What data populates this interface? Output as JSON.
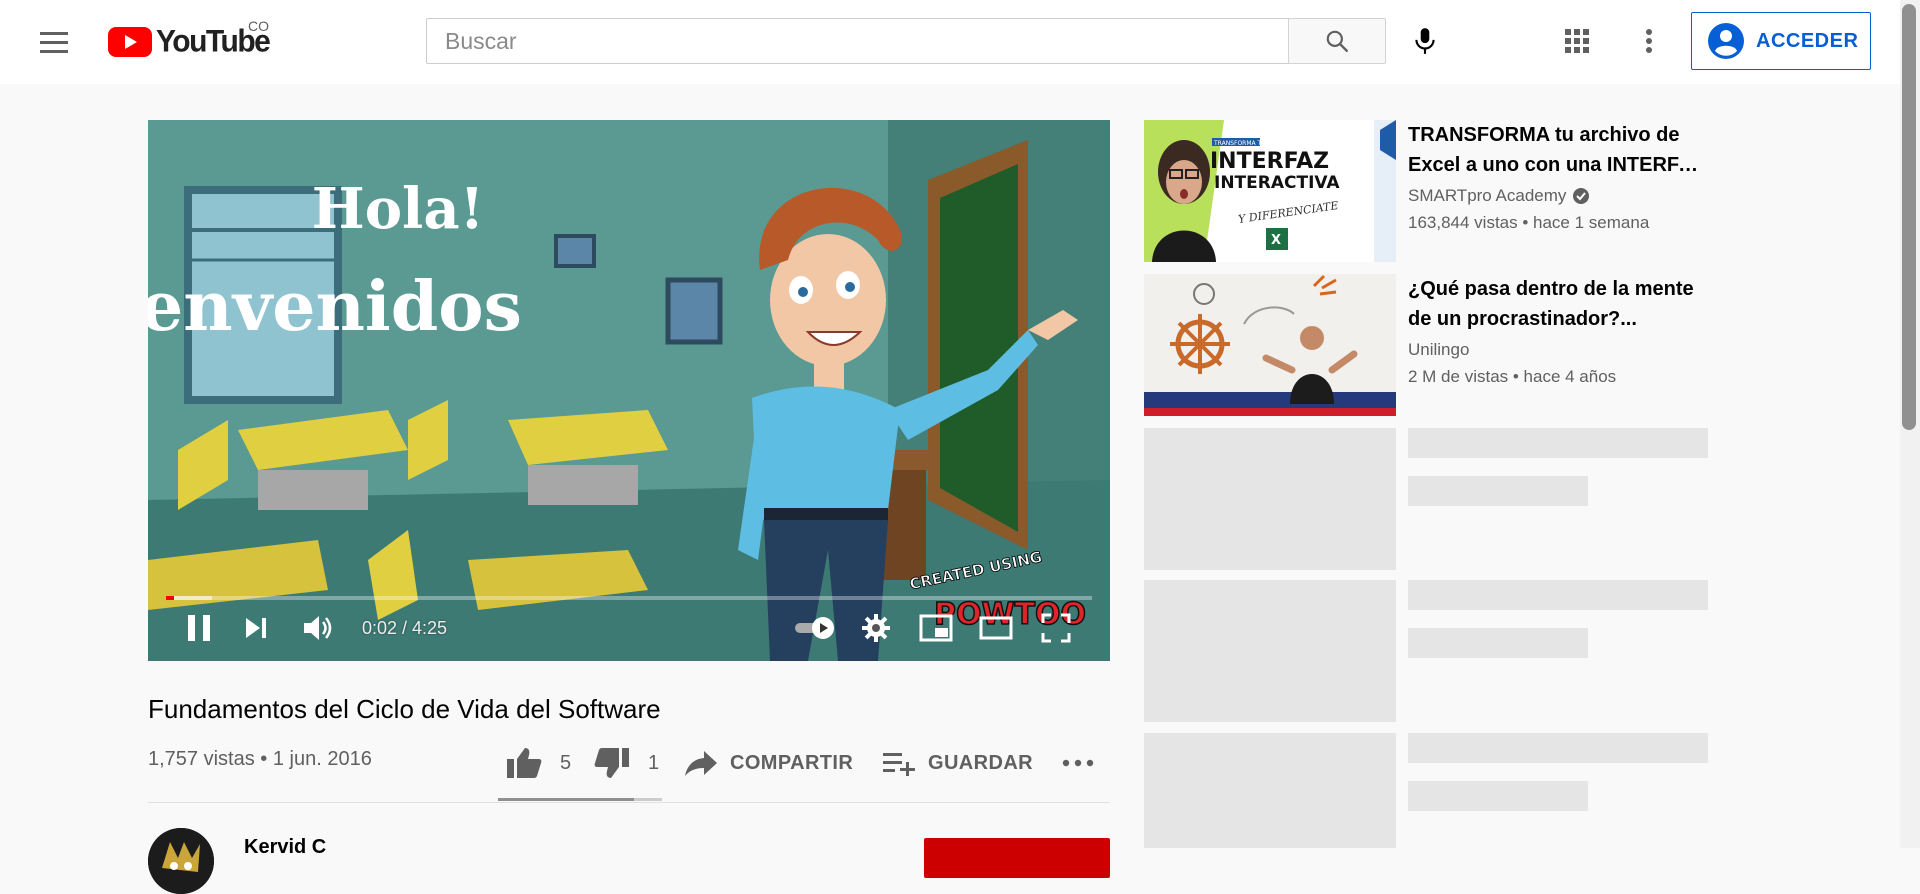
{
  "masthead": {
    "logo_text": "YouTube",
    "country_code": "CO",
    "search_placeholder": "Buscar",
    "signin_label": "ACCEDER",
    "brand_color": "#ff0000",
    "accent_color": "#065fd4"
  },
  "player": {
    "overlay_line1": "Hola!",
    "overlay_line2": "envenidos",
    "watermark_top": "CREATED USING",
    "watermark_brand": "POWTOON",
    "time_display": "0:02 / 4:25",
    "progress_played_fraction": 0.008,
    "progress_buffered_fraction": 0.05,
    "state": "playing",
    "controls": [
      "pause-icon",
      "next-icon",
      "volume-icon",
      "autoplay-toggle",
      "settings-icon",
      "miniplayer-icon",
      "theater-icon",
      "fullscreen-icon"
    ]
  },
  "video": {
    "title": "Fundamentos del Ciclo de Vida del Software",
    "meta": "1,757 vistas • 1 jun. 2016",
    "likes": "5",
    "dislikes": "1",
    "like_fraction": 0.83,
    "share_label": "COMPARTIR",
    "save_label": "GUARDAR",
    "channel_name": "Kervid C"
  },
  "related": [
    {
      "title": "TRANSFORMA tu archivo de Excel a uno con una INTERFAZ INTERACTIVA",
      "channel": "SMARTpro Academy",
      "verified": true,
      "stats": "163,844 vistas • hace 1 semana",
      "thumb_text_small": "TRANSFORMA TUS ARCHIVOS CON UNA",
      "thumb_text_big1": "INTERFAZ",
      "thumb_text_big2": "INTERACTIVA",
      "thumb_text_script": "Y DIFERENCIATE"
    },
    {
      "title": "¿Qué pasa dentro de la mente de un procrastinador?...",
      "channel": "Unilingo",
      "verified": false,
      "stats": "2 M de vistas • hace 4 años"
    }
  ]
}
